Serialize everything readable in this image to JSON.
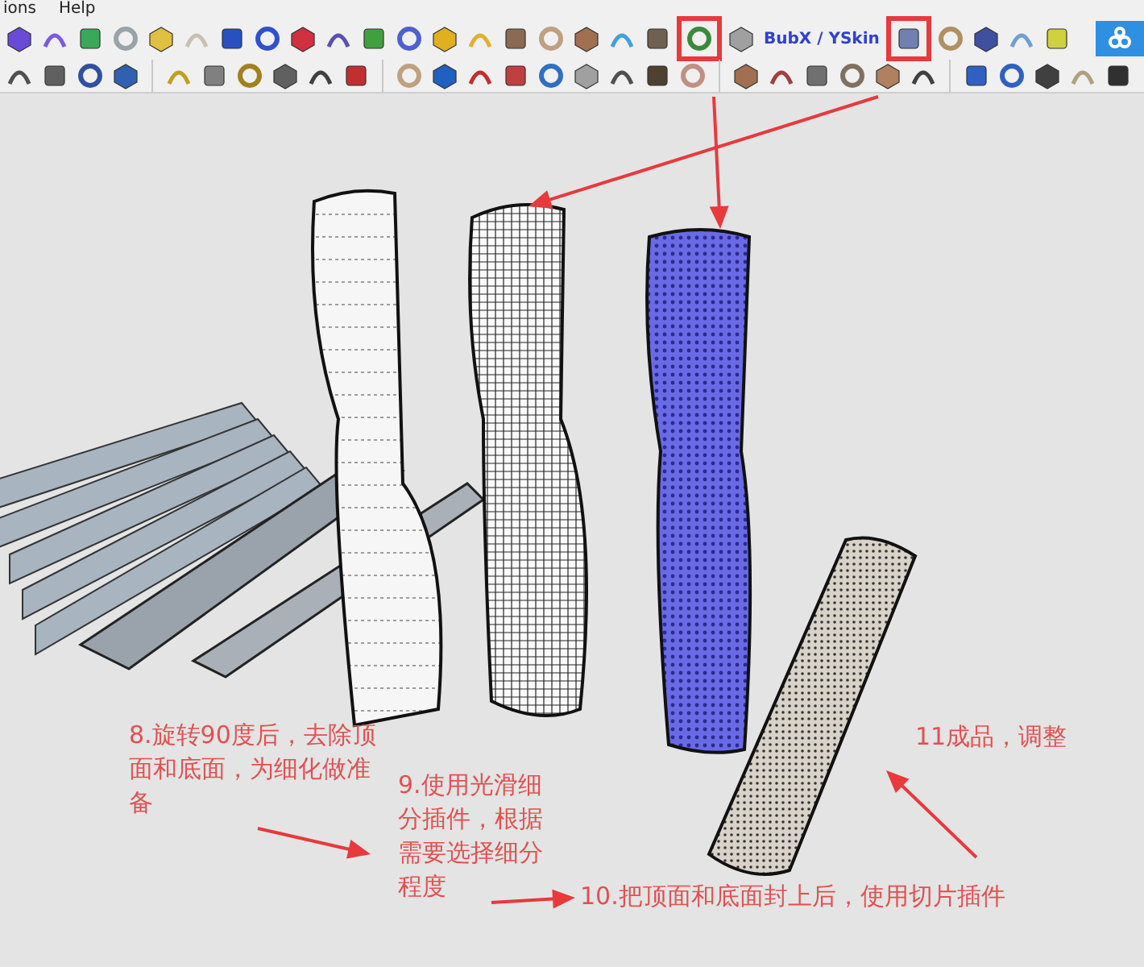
{
  "menu": [
    "ions",
    "Help"
  ],
  "toolbar": {
    "label": "BubX / YSkin"
  },
  "annotations": [
    {
      "text": "8.旋转90度后，去除顶面和底面，为细化做准备"
    },
    {
      "text": "9.使用光滑细分插件，根据需要选择细分程度"
    },
    {
      "text": "10.把顶面和底面封上后，使用切片插件"
    },
    {
      "text": "11成品，调整"
    }
  ]
}
